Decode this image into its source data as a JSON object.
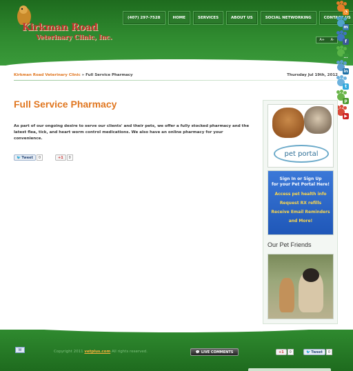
{
  "brand": {
    "line1": "Kirkman Road",
    "line2": "Veterinary Clinic, Inc."
  },
  "nav": [
    {
      "label": "(407) 297-7528",
      "name": "nav-phone"
    },
    {
      "label": "HOME",
      "name": "nav-home"
    },
    {
      "label": "SERVICES",
      "name": "nav-services"
    },
    {
      "label": "ABOUT US",
      "name": "nav-about-us"
    },
    {
      "label": "SOCIAL NETWORKING",
      "name": "nav-social-networking"
    },
    {
      "label": "CONTACT US",
      "name": "nav-contact-us"
    }
  ],
  "tools": {
    "increase": "A+",
    "decrease": "A-"
  },
  "social": [
    {
      "icon": "rss-icon",
      "color": "#e27d28",
      "glyph": "◔",
      "glyph_bg": "#f08a24"
    },
    {
      "icon": "myspace-icon",
      "color": "#4ea3c9",
      "glyph": "m",
      "glyph_bg": "#3d77b4"
    },
    {
      "icon": "facebook-icon",
      "color": "#3f73c0",
      "glyph": "f",
      "glyph_bg": "#3b5998"
    },
    {
      "icon": "chat-icon",
      "color": "#59b447",
      "glyph": "…",
      "glyph_bg": "#3a9a3a"
    },
    {
      "icon": "linkedin-icon",
      "color": "#5b9dd0",
      "glyph": "in",
      "glyph_bg": "#1d6fa5"
    },
    {
      "icon": "twitter-icon",
      "color": "#6cb2dd",
      "glyph": "t",
      "glyph_bg": "#33aadd"
    },
    {
      "icon": "plaxo-icon",
      "color": "#6ab54a",
      "glyph": "p",
      "glyph_bg": "#4b9a2f"
    },
    {
      "icon": "youtube-icon",
      "color": "#d94a3a",
      "glyph": "▶",
      "glyph_bg": "#cc2222"
    }
  ],
  "breadcrumb": {
    "home": "Kirkman Road Veterinary Clinic",
    "separator": "»",
    "current": "Full Service Pharmacy"
  },
  "date": "Thursday Jul 19th, 2012",
  "main": {
    "title": "Full Service Pharmacy",
    "intro": "As part of our ongoing desire to serve our clients' and their pets, we offer a fully stocked pharmacy and the latest flea, tick, and heart worm control medications.  We also have an online pharmacy for your convenience."
  },
  "share": {
    "tweet_label": "Tweet",
    "tweet_count": "0",
    "gplus_label": "+1",
    "gplus_count": "0"
  },
  "sidebar": {
    "portal_logo": "pet portal",
    "signup_head1": "Sign In or Sign Up",
    "signup_head2": "for your Pet Portal Here!",
    "links": [
      "Access pet health info",
      "Request RX refills",
      "Receive Email Reminders",
      "and More!"
    ],
    "pet_friends_title": "Our Pet Friends"
  },
  "footer": {
    "copyright_prefix": "Copyright 2011 ",
    "brand": "vetplus.com",
    "copyright_suffix": " All rights reserved.",
    "live_comments": "LIVE COMMENTS",
    "gplus_label": "+1",
    "gplus_count": "0",
    "tweet_label": "Tweet",
    "tweet_count": "0",
    "feed_icon_label": "W"
  }
}
